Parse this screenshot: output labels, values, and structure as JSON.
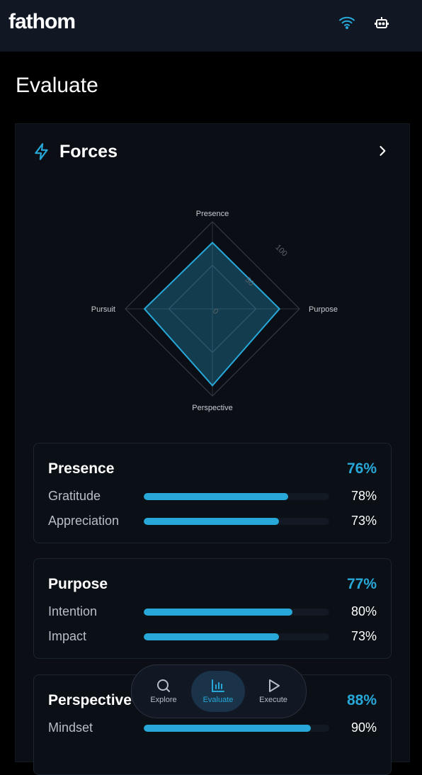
{
  "app": {
    "logo": "fathom",
    "page_title": "Evaluate"
  },
  "header": {
    "icons": [
      "wifi-icon",
      "robot-icon"
    ]
  },
  "forces": {
    "title": "Forces",
    "radar": {
      "axes": [
        "Presence",
        "Purpose",
        "Perspective",
        "Pursuit"
      ],
      "values": [
        76,
        77,
        88,
        78
      ],
      "rings": [
        0,
        50,
        100
      ],
      "accent": "#27a8d8"
    }
  },
  "cards": [
    {
      "title": "Presence",
      "score": "76%",
      "items": [
        {
          "label": "Gratitude",
          "value": "78%",
          "fraction": 0.78
        },
        {
          "label": "Appreciation",
          "value": "73%",
          "fraction": 0.73
        }
      ]
    },
    {
      "title": "Purpose",
      "score": "77%",
      "items": [
        {
          "label": "Intention",
          "value": "80%",
          "fraction": 0.8
        },
        {
          "label": "Impact",
          "value": "73%",
          "fraction": 0.73
        }
      ]
    },
    {
      "title": "Perspective",
      "score": "88%",
      "items": [
        {
          "label": "Mindset",
          "value": "90%",
          "fraction": 0.9
        }
      ]
    }
  ],
  "nav": {
    "items": [
      {
        "label": "Explore",
        "icon": "search-icon"
      },
      {
        "label": "Evaluate",
        "icon": "bar-chart-icon",
        "active": true
      },
      {
        "label": "Execute",
        "icon": "play-icon"
      }
    ]
  },
  "colors": {
    "accent": "#27a8d8",
    "background": "#000000",
    "panel": "#0b0f15"
  }
}
